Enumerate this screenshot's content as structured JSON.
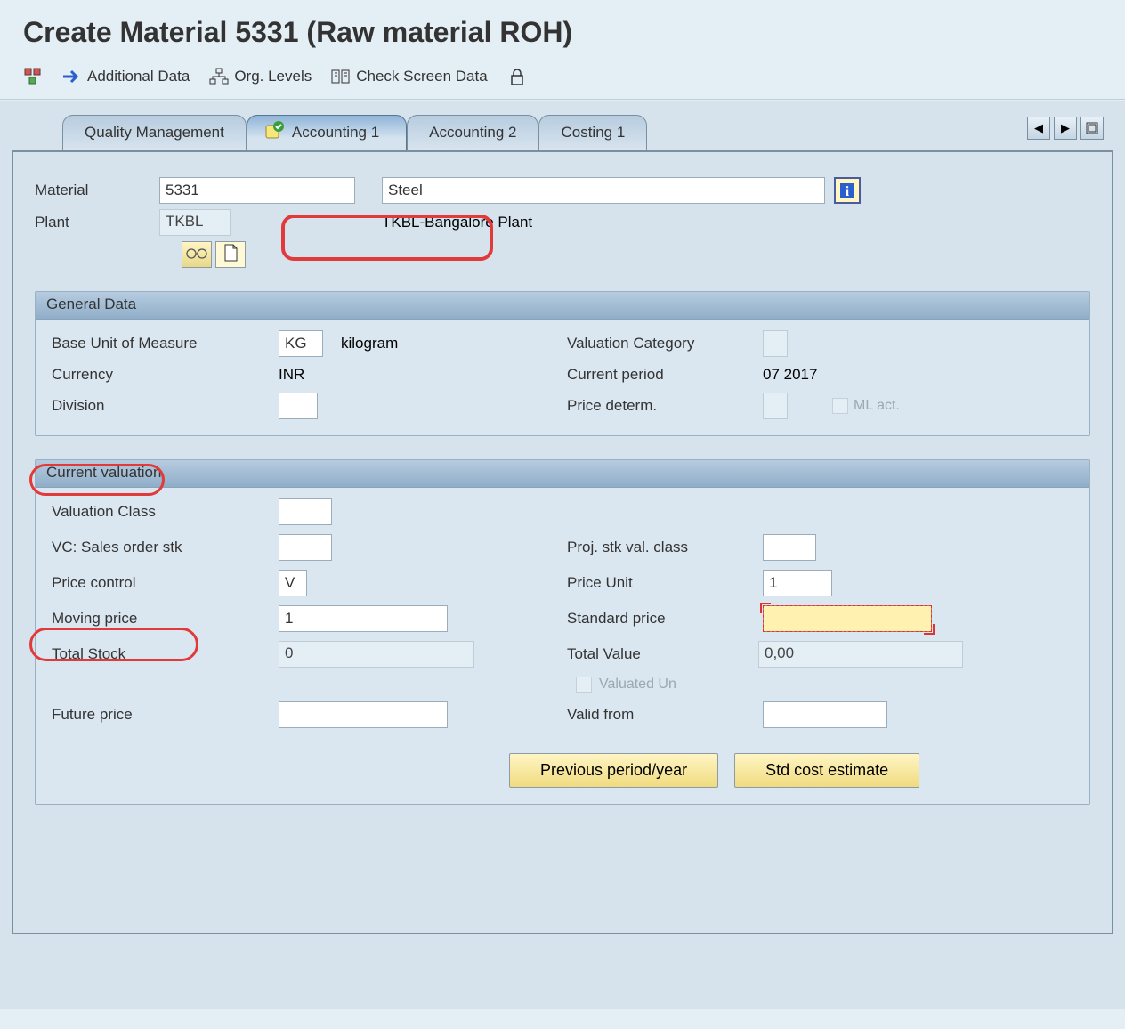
{
  "title": "Create Material 5331 (Raw material ROH)",
  "toolbar": {
    "additional_data": "Additional Data",
    "org_levels": "Org. Levels",
    "check_screen": "Check Screen Data"
  },
  "tabs": {
    "quality": "Quality Management",
    "accounting1": "Accounting 1",
    "accounting2": "Accounting 2",
    "costing1": "Costing 1"
  },
  "header": {
    "material_label": "Material",
    "material_value": "5331",
    "material_desc": "Steel",
    "plant_label": "Plant",
    "plant_value": "TKBL",
    "plant_desc": "TKBL-Bangalore Plant"
  },
  "general": {
    "title": "General Data",
    "base_uom_label": "Base Unit of Measure",
    "base_uom_value": "KG",
    "base_uom_desc": "kilogram",
    "currency_label": "Currency",
    "currency_value": "INR",
    "division_label": "Division",
    "division_value": "",
    "val_cat_label": "Valuation Category",
    "val_cat_value": "",
    "current_period_label": "Current period",
    "current_period_value": "07 2017",
    "price_determ_label": "Price determ.",
    "price_determ_value": "",
    "ml_act_label": "ML act."
  },
  "valuation": {
    "title": "Current valuation",
    "val_class_label": "Valuation Class",
    "val_class_value": "",
    "vc_sales_label": "VC: Sales order stk",
    "vc_sales_value": "",
    "proj_stk_label": "Proj. stk val. class",
    "proj_stk_value": "",
    "price_control_label": "Price control",
    "price_control_value": "V",
    "price_unit_label": "Price Unit",
    "price_unit_value": "1",
    "moving_price_label": "Moving price",
    "moving_price_value": "1",
    "std_price_label": "Standard price",
    "std_price_value": "",
    "total_stock_label": "Total Stock",
    "total_stock_value": "0",
    "total_value_label": "Total Value",
    "total_value_value": "0,00",
    "valuated_un_label": "Valuated Un",
    "future_price_label": "Future price",
    "future_price_value": "",
    "valid_from_label": "Valid from",
    "valid_from_value": "",
    "prev_period_btn": "Previous period/year",
    "std_cost_btn": "Std cost estimate"
  }
}
